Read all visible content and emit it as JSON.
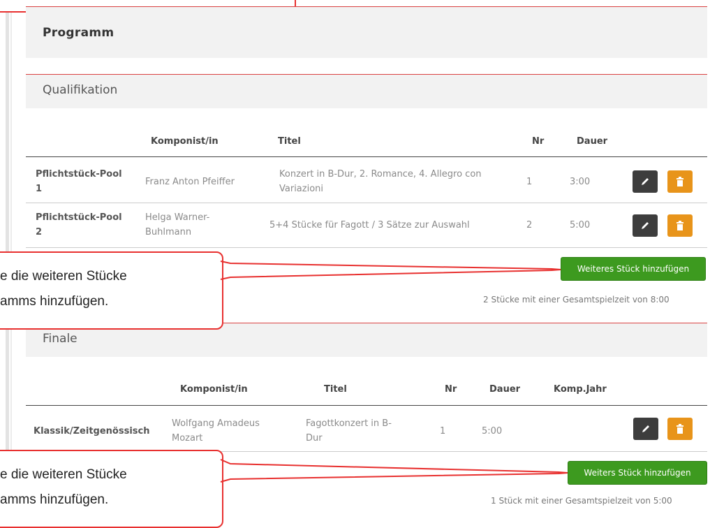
{
  "program": {
    "title": "Programm"
  },
  "qualification": {
    "title": "Qualifikation",
    "headers": {
      "composer": "Komponist/in",
      "title": "Titel",
      "nr": "Nr",
      "duration": "Dauer"
    },
    "rows": [
      {
        "category": "Pflichtstück-Pool 1",
        "category_l1": "Pflichtstück-Pool",
        "category_l2": "1",
        "composer_l1": "Franz Anton Pfeiffer",
        "composer_l2": "",
        "title_l1": "Konzert in B-Dur, 2. Romance, 4. Allegro con",
        "title_l2": "Variazioni",
        "nr": "1",
        "duration": "3:00"
      },
      {
        "category_l1": "Pflichtstück-Pool",
        "category_l2": "2",
        "composer_l1": "Helga Warner-",
        "composer_l2": "Buhlmann",
        "title_l1": "5+4 Stücke für Fagott / 3 Sätze zur Auswahl",
        "title_l2": "",
        "nr": "2",
        "duration": "5:00"
      }
    ],
    "add_button": "Weiteres Stück hinzufügen",
    "summary": "2 Stücke mit einer Gesamtspielzeit von 8:00"
  },
  "finale": {
    "title": "Finale",
    "headers": {
      "composer": "Komponist/in",
      "title": "Titel",
      "nr": "Nr",
      "duration": "Dauer",
      "year": "Komp.Jahr"
    },
    "rows": [
      {
        "category": "Klassik/Zeitgenössisch",
        "composer_l1": "Wolfgang Amadeus",
        "composer_l2": "Mozart",
        "title_l1": "Fagottkonzert in B-",
        "title_l2": "Dur",
        "nr": "1",
        "duration": "5:00",
        "year": ""
      }
    ],
    "add_button": "Weiters Stück hinzufügen",
    "summary": "1 Stück mit einer Gesamtspielzeit von 5:00"
  },
  "callouts": [
    {
      "line1": "e die weiteren Stücke",
      "line2": "amms hinzufügen."
    },
    {
      "line1": "e die weiteren Stücke",
      "line2": "amms hinzufügen."
    }
  ],
  "icons": {
    "edit": "pencil-icon",
    "delete": "trash-icon"
  },
  "colors": {
    "accent_red": "#e8302f",
    "green_button": "#3d9a1f",
    "edit_button": "#3d3d3d",
    "delete_button": "#e8941a"
  }
}
